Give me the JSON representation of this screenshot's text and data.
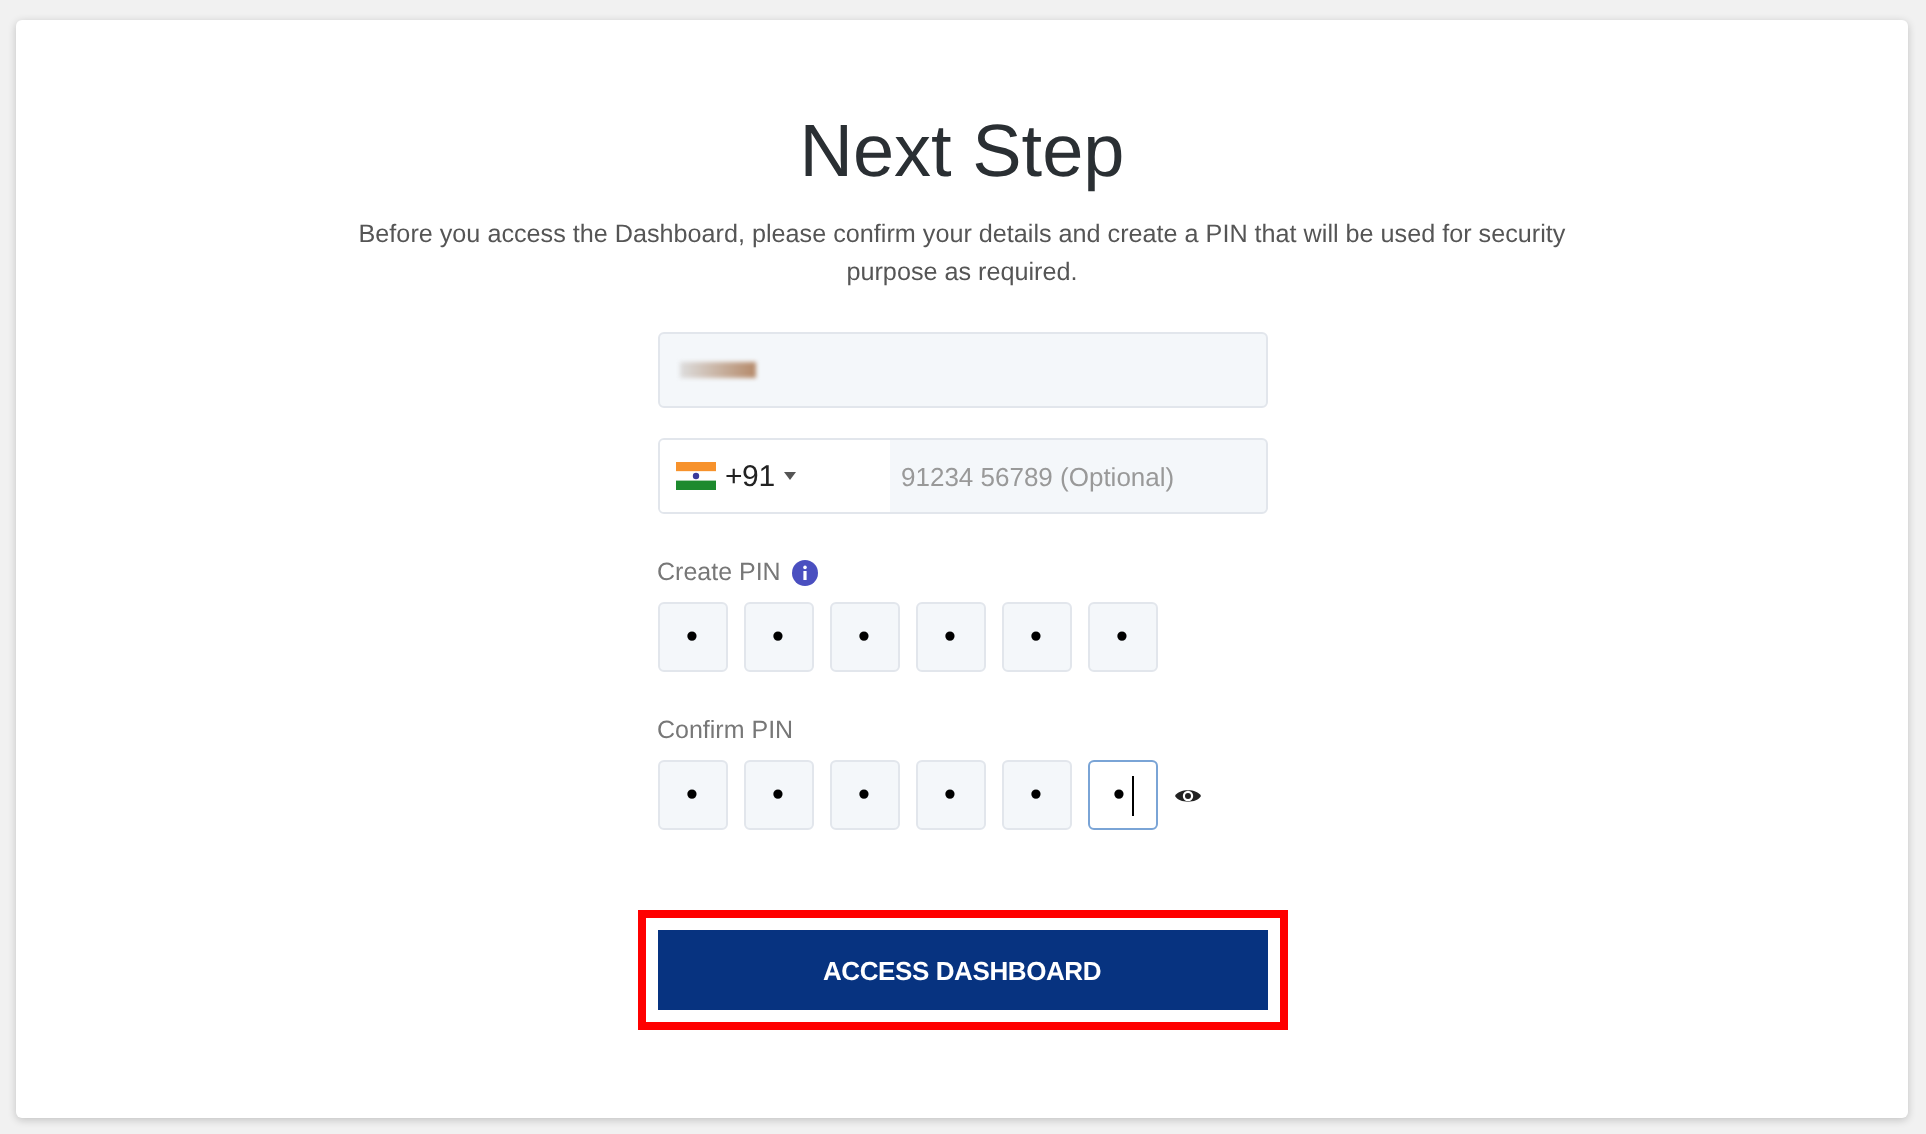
{
  "title": "Next Step",
  "description": "Before you access the Dashboard, please confirm your details and create a PIN that will be used for security purpose as required.",
  "name_field": {
    "redacted": true
  },
  "phone_field": {
    "country_code": "+91",
    "placeholder": "91234 56789 (Optional)"
  },
  "pin_groups": [
    {
      "label": "Create PIN",
      "info_icon": true,
      "reveal_icon": false,
      "boxes": [
        {
          "value": "•",
          "focused": false
        },
        {
          "value": "•",
          "focused": false
        },
        {
          "value": "•",
          "focused": false
        },
        {
          "value": "•",
          "focused": false
        },
        {
          "value": "•",
          "focused": false
        },
        {
          "value": "•",
          "focused": false
        }
      ]
    },
    {
      "label": "Confirm PIN",
      "info_icon": false,
      "reveal_icon": true,
      "boxes": [
        {
          "value": "•",
          "focused": false
        },
        {
          "value": "•",
          "focused": false
        },
        {
          "value": "•",
          "focused": false
        },
        {
          "value": "•",
          "focused": false
        },
        {
          "value": "•",
          "focused": false
        },
        {
          "value": "•",
          "focused": true
        }
      ]
    }
  ],
  "submit_button": {
    "label": "ACCESS DASHBOARD",
    "highlighted": true
  }
}
